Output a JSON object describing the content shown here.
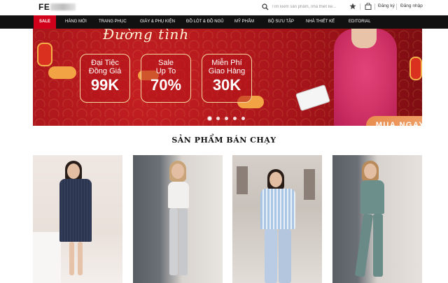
{
  "header": {
    "logo_text": "FE",
    "search_placeholder": "Tìm kiếm sản phẩm, nhà thiết kế...",
    "register_label": "Đăng ký",
    "login_label": "Đăng nhập"
  },
  "nav": {
    "items": [
      "SALE",
      "HÀNG MỚI",
      "TRANG PHỤC",
      "GIÀY & PHỤ KIỆN",
      "ĐỒ LÓT & ĐỒ NGỦ",
      "MỸ PHẨM",
      "BỘ SƯU TẬP",
      "NHÀ THIẾT KẾ",
      "EDITORIAL"
    ]
  },
  "banner": {
    "script_title": "Đường tình",
    "promos": [
      {
        "line1": "Đại Tiệc",
        "line2": "Đồng Giá",
        "big": "99K"
      },
      {
        "line1": "Sale",
        "line2": "Up To",
        "big": "70%"
      },
      {
        "line1": "Miễn Phí",
        "line2": "Giao Hàng",
        "big": "30K"
      }
    ],
    "cta_label": "MUA NGAY",
    "slide_count": 5,
    "active_slide": 1
  },
  "section": {
    "title": "SẢN PHẨM BÁN CHẠY"
  },
  "products": [
    {
      "name": "product-1",
      "outfit": "navy-pinstripe-blazer-dress"
    },
    {
      "name": "product-2",
      "outfit": "white-tank-grey-leggings"
    },
    {
      "name": "product-3",
      "outfit": "blue-striped-shirt-light-trousers"
    },
    {
      "name": "product-4",
      "outfit": "teal-bodysuit-set"
    }
  ],
  "colors": {
    "sale_red": "#d0021b",
    "nav_bg": "#111111",
    "banner_red": "#a5141a",
    "cta_orange": "#ec9a5e"
  }
}
